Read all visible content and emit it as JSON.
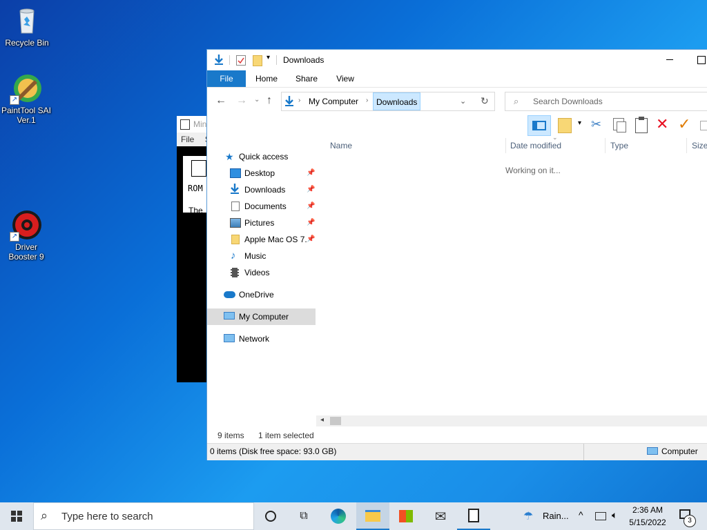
{
  "desktop": {
    "icons": [
      {
        "label": "Recycle Bin",
        "icon": "recycle-bin-icon"
      },
      {
        "label": "PaintTool SAI Ver.1",
        "icon": "painttool-sai-icon"
      },
      {
        "label": "Driver Booster 9",
        "icon": "driver-booster-icon"
      }
    ]
  },
  "bg_window": {
    "title": "Mini",
    "menu_file": "File",
    "menu_more": "S",
    "line1": "ROM",
    "line2": "The"
  },
  "explorer": {
    "title": "Downloads",
    "tabs": [
      "File",
      "Home",
      "Share",
      "View"
    ],
    "breadcrumb": [
      "My Computer",
      "Downloads"
    ],
    "search_placeholder": "Search Downloads",
    "columns": [
      "Name",
      "Date modified",
      "Type",
      "Size"
    ],
    "working_text": "Working on it...",
    "nav": {
      "quick_access": "Quick access",
      "items": [
        {
          "label": "Desktop",
          "pinned": true
        },
        {
          "label": "Downloads",
          "pinned": true
        },
        {
          "label": "Documents",
          "pinned": true
        },
        {
          "label": "Pictures",
          "pinned": true
        },
        {
          "label": "Apple Mac OS 7.",
          "pinned": true
        },
        {
          "label": "Music",
          "pinned": false
        },
        {
          "label": "Videos",
          "pinned": false
        }
      ],
      "onedrive": "OneDrive",
      "my_computer": "My Computer",
      "network": "Network"
    },
    "status_items": "9 items",
    "status_selected": "1 item selected",
    "bottom_left": "0 items (Disk free space: 93.0 GB)",
    "bottom_right": "Computer"
  },
  "taskbar": {
    "search_placeholder": "Type here to search",
    "weather": "Rain...",
    "time": "2:36 AM",
    "date": "5/15/2022",
    "notifications": "3"
  },
  "colors": {
    "accent": "#1979ca",
    "selected": "#cce8ff",
    "delete": "#e81123",
    "check": "#e07b00"
  }
}
